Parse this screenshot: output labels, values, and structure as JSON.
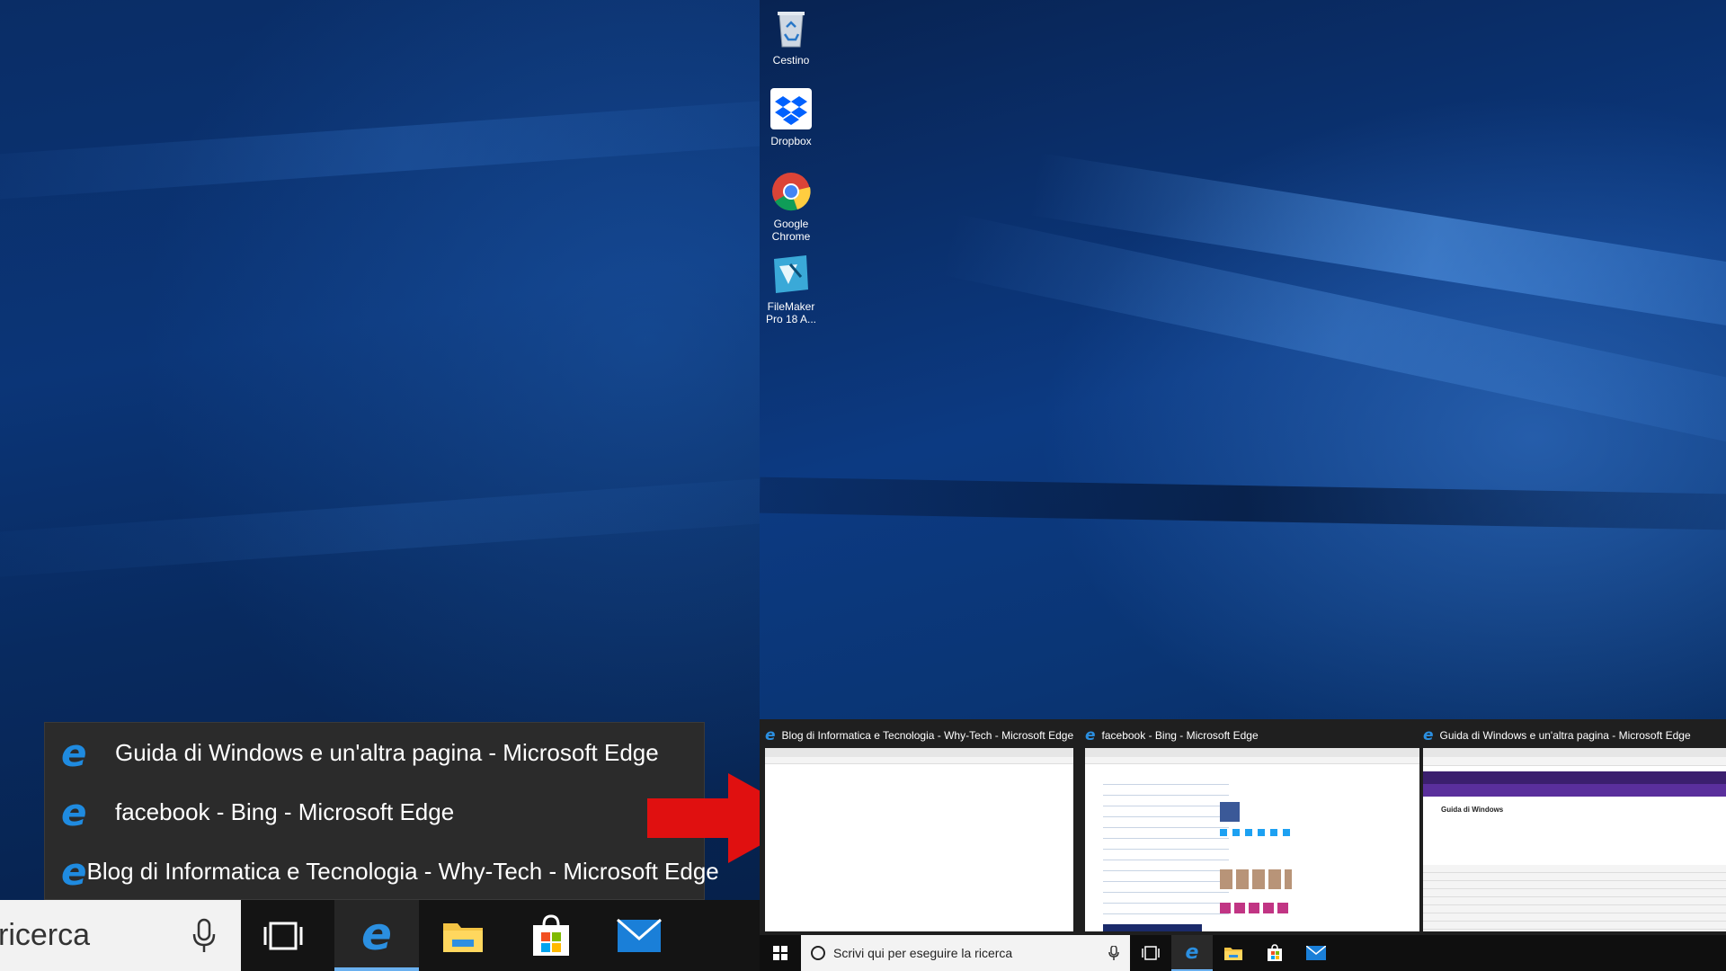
{
  "jumplist": {
    "items": [
      {
        "label": "Guida di Windows e un'altra pagina - Microsoft Edge",
        "icon": "edge-icon"
      },
      {
        "label": "facebook - Bing - Microsoft Edge",
        "icon": "edge-icon"
      },
      {
        "label": "Blog di Informatica e Tecnologia - Why-Tech - Microsoft Edge",
        "icon": "edge-icon"
      }
    ]
  },
  "left_taskbar": {
    "search_text": "ricerca",
    "icons": [
      "microphone-icon",
      "task-view-icon",
      "edge-icon",
      "file-explorer-icon",
      "store-icon",
      "mail-icon"
    ]
  },
  "desktop": {
    "icons": [
      {
        "label": "Cestino",
        "icon": "recycle-bin-icon"
      },
      {
        "label": "Dropbox",
        "icon": "dropbox-icon"
      },
      {
        "label": "Google Chrome",
        "icon": "chrome-icon"
      },
      {
        "label": "FileMaker Pro 18 A...",
        "icon": "filemaker-icon"
      }
    ]
  },
  "previews": [
    {
      "title": "Blog di Informatica e Tecnologia - Why-Tech - Microsoft Edge"
    },
    {
      "title": "facebook - Bing - Microsoft Edge"
    },
    {
      "title": "Guida di Windows e un'altra pagina - Microsoft Edge",
      "inner_label": "Guida di Windows"
    }
  ],
  "right_taskbar": {
    "search_placeholder": "Scrivi qui per eseguire la ricerca",
    "icons": [
      "windows-start-icon",
      "microphone-icon",
      "task-view-icon",
      "edge-icon",
      "file-explorer-icon",
      "store-icon",
      "mail-icon"
    ]
  },
  "colors": {
    "accent": "#1f8be0",
    "arrow": "#e01010",
    "jumplist_bg": "#2b2b2b"
  }
}
